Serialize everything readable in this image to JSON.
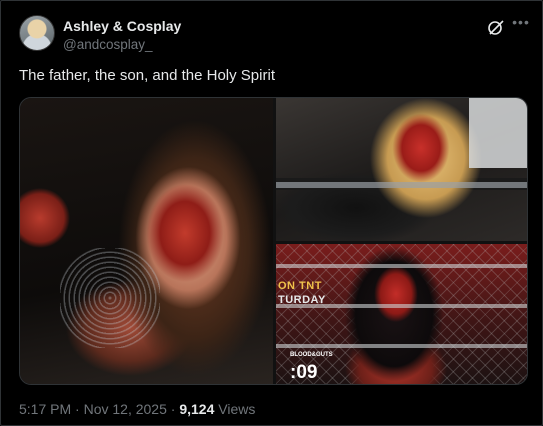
{
  "author": {
    "name": "Ashley & Cosplay",
    "handle": "@andcosplay_"
  },
  "header_icons": {
    "grok": "grok-icon",
    "more": "more-icon"
  },
  "tweet": {
    "text": "The father, the son, and the Holy Spirit"
  },
  "media": {
    "images": [
      {
        "icon": "photo",
        "description_slot": "left"
      },
      {
        "icon": "photo",
        "description_slot": "top-right"
      },
      {
        "icon": "photo",
        "description_slot": "bottom-right",
        "overlay": {
          "line1": "ON TNT",
          "line2": "TURDAY",
          "small": "BLOOD&GUTS",
          "timer": ":09"
        }
      }
    ]
  },
  "footer": {
    "time": "5:17 PM",
    "separator1": " · ",
    "date": "Nov 12, 2025",
    "separator2": " · ",
    "views_count": "9,124",
    "views_label": " Views"
  },
  "colors": {
    "background": "#000000",
    "text": "#e7e9ea",
    "muted": "#71767b",
    "border": "#2f3336"
  }
}
